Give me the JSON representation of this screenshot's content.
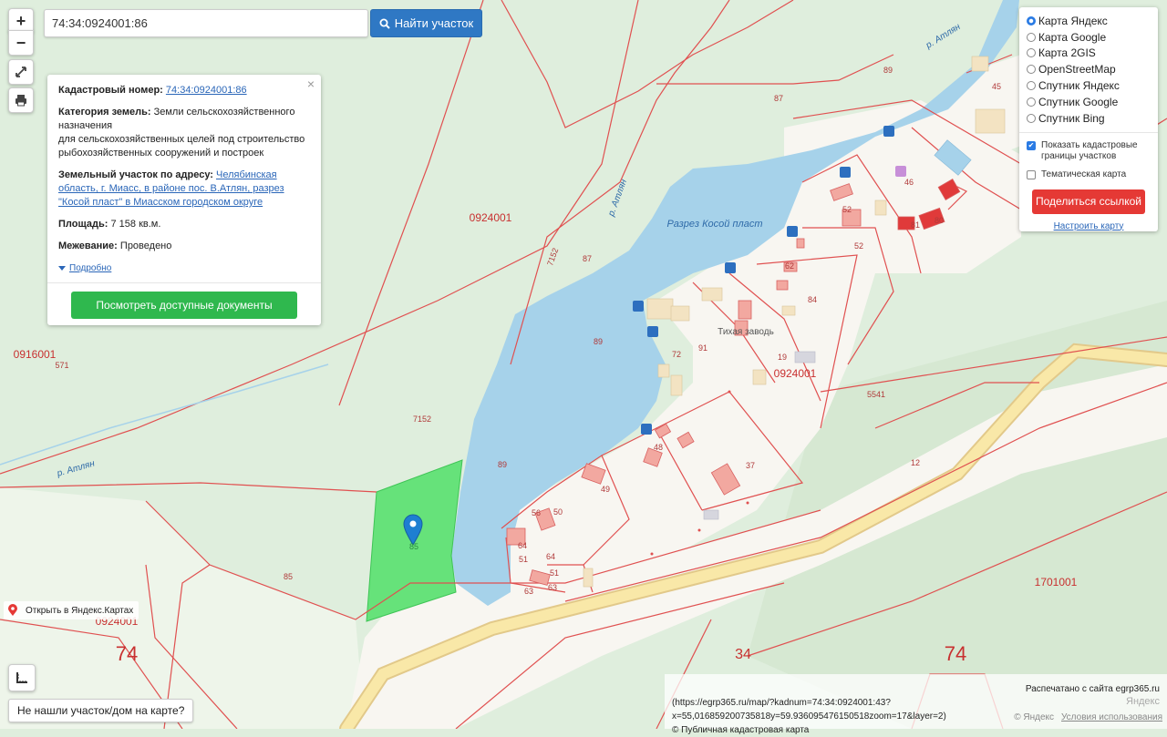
{
  "map": {
    "lake_name": "Разрез Косой пласт",
    "river_labels": [
      "р. Атлян",
      "р. Атлян",
      "р. Атлян"
    ],
    "settlement": "Тихая заводь",
    "quarter_labels": [
      "0924001",
      "0916001",
      "0924001",
      "0924001",
      "1701001"
    ],
    "region_codes": [
      "74",
      "74"
    ],
    "district_code": "34",
    "parcel_numbers": [
      "89",
      "87",
      "45",
      "46",
      "52",
      "52",
      "81",
      "80",
      "62",
      "84",
      "72",
      "91",
      "19",
      "5541",
      "48",
      "49",
      "37",
      "50",
      "56",
      "64",
      "51",
      "64",
      "51",
      "63",
      "63",
      "87",
      "7152",
      "7152",
      "89",
      "89",
      "571",
      "85",
      "12",
      "85"
    ],
    "selected_parcel_label": "85",
    "colors": {
      "background": "#dfeedd",
      "forest": "#d6e8d2",
      "lake": "#a6d2ea",
      "settlement": "#f8f6f1",
      "selected_parcel": "#66e27a",
      "cadastre_line": "#e05050",
      "road": "#f4e2a0",
      "marker": "#1e7fd1"
    }
  },
  "controls": {
    "zoom_in": "+",
    "zoom_out": "−",
    "fullscreen_icon": "expand-icon",
    "print_icon": "printer-icon"
  },
  "search": {
    "value": "74:34:0924001:86",
    "button_label": "Найти участок"
  },
  "info": {
    "cadastral_label": "Кадастровый номер:",
    "cadastral_value": "74:34:0924001:86",
    "category_label": "Категория земель:",
    "category_value": "Земли сельскохозяйственного назначения",
    "purpose": "для сельскохозяйственных целей под строительство рыбохозяйственных сооружений и построек",
    "address_label": "Земельный участок по адресу:",
    "address_value": "Челябинская область, г. Миасс, в районе пос. В.Атлян, разрез \"Косой пласт\" в Миасском городском округе",
    "area_label": "Площадь:",
    "area_value": "7 158 кв.м.",
    "survey_label": "Межевание:",
    "survey_value": "Проведено",
    "more_link": "Подробно",
    "docs_button": "Посмотреть доступные документы",
    "close": "×"
  },
  "layers": {
    "options": [
      {
        "label": "Карта Яндекс",
        "selected": true
      },
      {
        "label": "Карта Google",
        "selected": false
      },
      {
        "label": "Карта 2GIS",
        "selected": false
      },
      {
        "label": "OpenStreetMap",
        "selected": false
      },
      {
        "label": "Спутник Яндекс",
        "selected": false
      },
      {
        "label": "Спутник Google",
        "selected": false
      },
      {
        "label": "Спутник Bing",
        "selected": false
      }
    ],
    "show_borders": "Показать кадастровые границы участков",
    "show_borders_checked": true,
    "thematic": "Тематическая карта",
    "thematic_checked": false,
    "share_button": "Поделиться ссылкой",
    "configure_link": "Настроить карту"
  },
  "footer": {
    "open_yandex": "Открыть в Яндекс.Картах",
    "not_found": "Не нашли участок/дом на карте?",
    "printed_from": "Распечатано с сайта egrp365.ru",
    "printed_url": "(https://egrp365.ru/map/?kadnum=74:34:0924001:43?x=55,016859200735818y=59.936095476150518zoom=17&layer=2)",
    "public_map": "© Публичная кадастровая карта",
    "yandex_logo": "Яндекс",
    "yandex_copyright": "© Яндекс",
    "terms": "Условия использования"
  }
}
